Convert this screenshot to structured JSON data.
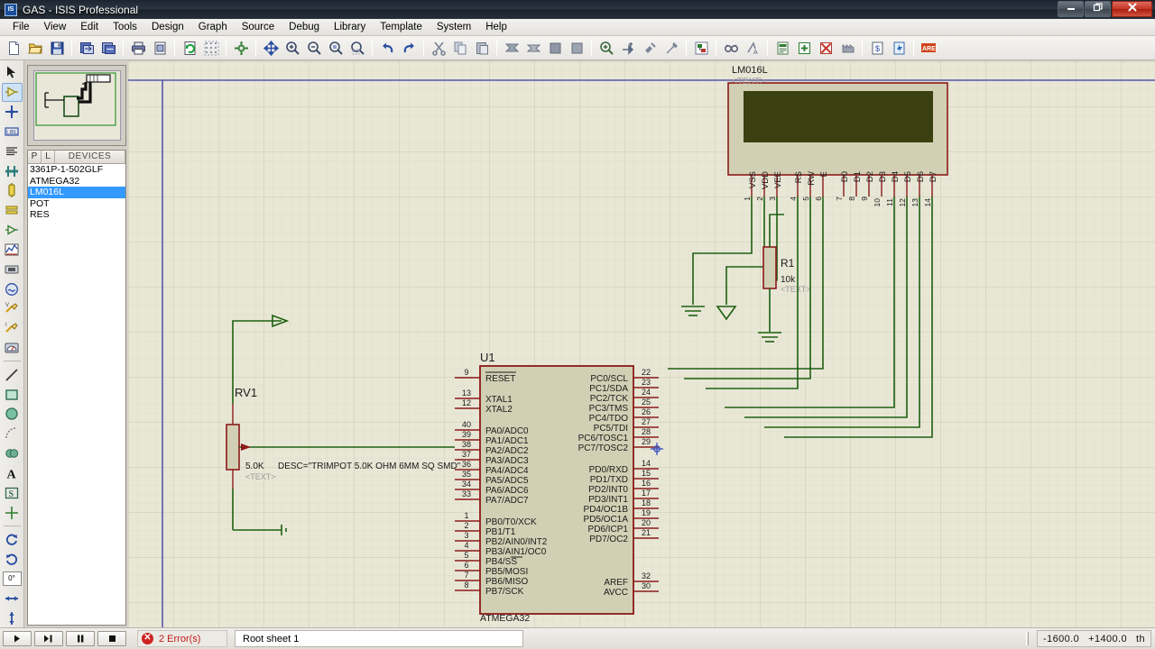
{
  "window": {
    "title": "GAS - ISIS Professional",
    "app_icon": "isis-icon",
    "buttons": {
      "minimize": "–",
      "restore": "❐",
      "close": "✕"
    }
  },
  "menubar": {
    "items": [
      "File",
      "View",
      "Edit",
      "Tools",
      "Design",
      "Graph",
      "Source",
      "Debug",
      "Library",
      "Template",
      "System",
      "Help"
    ]
  },
  "toolbar": {
    "groups": [
      [
        "new-file-icon",
        "open-file-icon",
        "save-file-icon"
      ],
      [
        "import-section-icon",
        "export-section-icon"
      ],
      [
        "print-icon",
        "print-area-icon"
      ],
      [
        "refresh-display-icon",
        "toggle-grid-icon"
      ],
      [
        "origin-icon"
      ],
      [
        "pan-icon",
        "zoom-in-icon",
        "zoom-out-icon",
        "zoom-all-icon",
        "zoom-area-icon"
      ],
      [
        "undo-icon",
        "redo-icon"
      ],
      [
        "cut-icon",
        "copy-icon",
        "paste-icon"
      ],
      [
        "block-copy-icon",
        "block-move-icon",
        "block-rotate-icon",
        "block-delete-icon"
      ],
      [
        "pick-device-icon",
        "make-device-icon",
        "packaging-tool-icon",
        "decompose-icon"
      ],
      [
        "toggle-netlist-icon"
      ],
      [
        "design-explorer-icon",
        "auto-annotate-icon"
      ],
      [
        "bom-report-icon",
        "erc-report-icon",
        "netlist-compiler-icon",
        "model-fetch-icon"
      ],
      [
        "netlist-spice-icon",
        "netlist-energy-icon"
      ],
      [
        "ares-icon"
      ]
    ]
  },
  "left_toolstrip": {
    "items": [
      {
        "name": "selection-mode-icon",
        "selected": false
      },
      {
        "name": "component-mode-icon",
        "selected": true
      },
      {
        "name": "junction-dot-icon",
        "selected": false
      },
      {
        "name": "wire-label-icon",
        "selected": false
      },
      {
        "name": "text-script-icon",
        "selected": false
      },
      {
        "name": "buses-icon",
        "selected": false
      },
      {
        "name": "subcircuit-icon",
        "selected": false
      },
      {
        "name": "terminals-mode-icon",
        "selected": false
      },
      {
        "name": "device-pins-icon",
        "selected": false
      },
      {
        "name": "graph-mode-icon",
        "selected": false
      },
      {
        "name": "tape-recorder-icon",
        "selected": false
      },
      {
        "name": "generator-mode-icon",
        "selected": false
      },
      {
        "name": "voltage-probe-icon",
        "selected": false
      },
      {
        "name": "current-probe-icon",
        "selected": false
      },
      {
        "name": "virtual-instruments-icon",
        "selected": false
      },
      {
        "name": "line-tool-icon",
        "selected": false
      },
      {
        "name": "box-tool-icon",
        "selected": false
      },
      {
        "name": "circle-tool-icon",
        "selected": false
      },
      {
        "name": "arc-tool-icon",
        "selected": false
      },
      {
        "name": "closed-path-tool-icon",
        "selected": false
      },
      {
        "name": "text-tool-icon",
        "selected": false
      },
      {
        "name": "symbol-tool-icon",
        "selected": false
      },
      {
        "name": "marker-tool-icon",
        "selected": false
      },
      {
        "name": "rotate-clockwise-icon",
        "selected": false
      },
      {
        "name": "rotate-anticlockwise-icon",
        "selected": false
      },
      {
        "name": "rotation-angle-field",
        "value": "0°",
        "selected": false
      },
      {
        "name": "mirror-horizontal-icon",
        "selected": false
      },
      {
        "name": "mirror-vertical-icon",
        "selected": false
      }
    ]
  },
  "devices_panel": {
    "columns": [
      "P",
      "L",
      "DEVICES"
    ],
    "items": [
      {
        "label": "3361P-1-502GLF",
        "selected": false
      },
      {
        "label": "ATMEGA32",
        "selected": false
      },
      {
        "label": "LM016L",
        "selected": true
      },
      {
        "label": "POT",
        "selected": false
      },
      {
        "label": "RES",
        "selected": false
      }
    ]
  },
  "statusbar": {
    "animation_buttons": [
      "play-button",
      "step-button",
      "pause-button",
      "stop-button"
    ],
    "errors_icon": "error-icon",
    "errors_text": "2 Error(s)",
    "sheet": "Root sheet 1",
    "coordinates": {
      "x": "-1600.0",
      "y": "+1400.0",
      "units": "th"
    }
  },
  "schematic": {
    "colors": {
      "background": "#e8e7d6",
      "grid_minor": "#dedcc9",
      "grid_major": "#cdcbb6",
      "wire": "#1d6010",
      "body_outline": "#8b1a1a",
      "body_fill": "#d2d0b4",
      "pin": "#8b1a1a",
      "text": "#1a1a1a",
      "lcd_screen": "#3b4010",
      "property_text": "#9a9a9a",
      "sheet_border": "#4a4a8a"
    },
    "components": [
      {
        "name": "lcd-display",
        "reference": "LM016L",
        "property_text": "<TEXT>",
        "pin_labels": [
          "VSS",
          "VDD",
          "VEE",
          "RS",
          "RW",
          "E",
          "D0",
          "D1",
          "D2",
          "D3",
          "D4",
          "D5",
          "D6",
          "D7"
        ],
        "pin_numbers": [
          "1",
          "2",
          "3",
          "4",
          "5",
          "6",
          "7",
          "8",
          "9",
          "10",
          "11",
          "12",
          "13",
          "14"
        ]
      },
      {
        "name": "resistor-r1",
        "reference": "R1",
        "value": "10k",
        "property_text": "<TEXT>"
      },
      {
        "name": "potentiometer-rv1",
        "reference": "RV1",
        "value": "5.0K",
        "description": "DESC=\"TRIMPOT 5.0K OHM 6MM SQ SMD\"",
        "property_text": "<TEXT>"
      },
      {
        "name": "microcontroller-u1",
        "reference": "U1",
        "device": "ATMEGA32",
        "left_pins": [
          {
            "num": "9",
            "label": "RESET",
            "overline": true
          },
          {
            "num": "13",
            "label": "XTAL1"
          },
          {
            "num": "12",
            "label": "XTAL2"
          },
          {
            "num": "40",
            "label": "PA0/ADC0"
          },
          {
            "num": "39",
            "label": "PA1/ADC1"
          },
          {
            "num": "38",
            "label": "PA2/ADC2"
          },
          {
            "num": "37",
            "label": "PA3/ADC3"
          },
          {
            "num": "36",
            "label": "PA4/ADC4"
          },
          {
            "num": "35",
            "label": "PA5/ADC5"
          },
          {
            "num": "34",
            "label": "PA6/ADC6"
          },
          {
            "num": "33",
            "label": "PA7/ADC7"
          },
          {
            "num": "1",
            "label": "PB0/T0/XCK"
          },
          {
            "num": "2",
            "label": "PB1/T1"
          },
          {
            "num": "3",
            "label": "PB2/AIN0/INT2"
          },
          {
            "num": "4",
            "label": "PB3/AIN1/OC0"
          },
          {
            "num": "5",
            "label": "PB4/SS",
            "overline_tail": "SS"
          },
          {
            "num": "6",
            "label": "PB5/MOSI"
          },
          {
            "num": "7",
            "label": "PB6/MISO"
          },
          {
            "num": "8",
            "label": "PB7/SCK"
          }
        ],
        "right_pins": [
          {
            "num": "22",
            "label": "PC0/SCL"
          },
          {
            "num": "23",
            "label": "PC1/SDA"
          },
          {
            "num": "24",
            "label": "PC2/TCK"
          },
          {
            "num": "25",
            "label": "PC3/TMS"
          },
          {
            "num": "26",
            "label": "PC4/TDO"
          },
          {
            "num": "27",
            "label": "PC5/TDI"
          },
          {
            "num": "28",
            "label": "PC6/TOSC1"
          },
          {
            "num": "29",
            "label": "PC7/TOSC2"
          },
          {
            "num": "14",
            "label": "PD0/RXD"
          },
          {
            "num": "15",
            "label": "PD1/TXD"
          },
          {
            "num": "16",
            "label": "PD2/INT0"
          },
          {
            "num": "17",
            "label": "PD3/INT1"
          },
          {
            "num": "18",
            "label": "PD4/OC1B"
          },
          {
            "num": "19",
            "label": "PD5/OC1A"
          },
          {
            "num": "20",
            "label": "PD6/ICP1"
          },
          {
            "num": "21",
            "label": "PD7/OC2"
          },
          {
            "num": "32",
            "label": "AREF"
          },
          {
            "num": "30",
            "label": "AVCC"
          }
        ]
      }
    ]
  }
}
